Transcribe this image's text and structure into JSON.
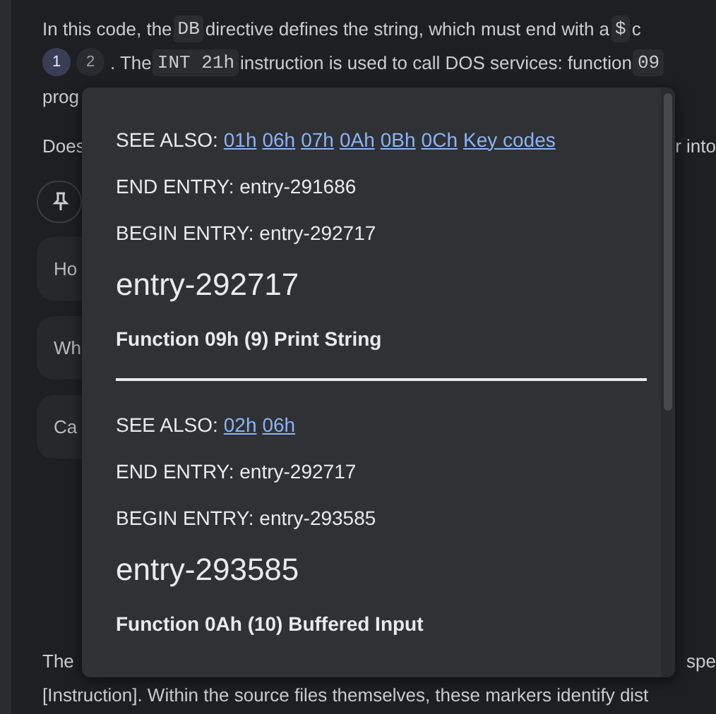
{
  "chat": {
    "top_lines": [
      {
        "left": [
          {
            "kind": "text",
            "text": "In this code, the "
          },
          {
            "kind": "code",
            "text": "DB"
          },
          {
            "kind": "text",
            "text": " directive defines the string, which must end with a "
          },
          {
            "kind": "code",
            "text": "$"
          },
          {
            "kind": "text",
            "text": " c"
          }
        ]
      },
      {
        "left": [
          {
            "kind": "cite",
            "text": "1",
            "selected": true
          },
          {
            "kind": "cite",
            "text": "2",
            "selected": false
          },
          {
            "kind": "text",
            "text": ". The "
          },
          {
            "kind": "code",
            "text": "INT 21h"
          },
          {
            "kind": "text",
            "text": " instruction is used to call DOS services: function "
          },
          {
            "kind": "code",
            "text": "09"
          }
        ]
      },
      {
        "left": [
          {
            "kind": "text",
            "text": "prog"
          }
        ]
      },
      {
        "left": [
          {
            "kind": "text",
            "text": "Does"
          }
        ],
        "right": [
          {
            "kind": "text",
            "text": "r into"
          }
        ]
      }
    ],
    "suggestions": [
      "Ho",
      "Wh",
      "Ca"
    ],
    "bottom_lines": [
      {
        "left": [
          {
            "kind": "text",
            "text": "The"
          }
        ],
        "right": [
          {
            "kind": "text",
            "text": "spe"
          }
        ]
      },
      {
        "left": [
          {
            "kind": "text",
            "text": "[Instruction]. Within the source files themselves, these markers identify dist"
          }
        ]
      }
    ]
  },
  "popup": {
    "sections": [
      {
        "see_also_label": "SEE ALSO:",
        "links": [
          "01h",
          "06h",
          "07h",
          "0Ah",
          "0Bh",
          "0Ch",
          "Key codes"
        ],
        "end_entry": "END ENTRY: entry-291686",
        "begin_entry": "BEGIN ENTRY: entry-292717",
        "heading": "entry-292717",
        "function": "Function 09h (9) Print String"
      },
      {
        "see_also_label": "SEE ALSO:",
        "links": [
          "02h",
          "06h"
        ],
        "end_entry": "END ENTRY: entry-292717",
        "begin_entry": "BEGIN ENTRY: entry-293585",
        "heading": "entry-293585",
        "function": "Function 0Ah (10) Buffered Input"
      }
    ]
  }
}
